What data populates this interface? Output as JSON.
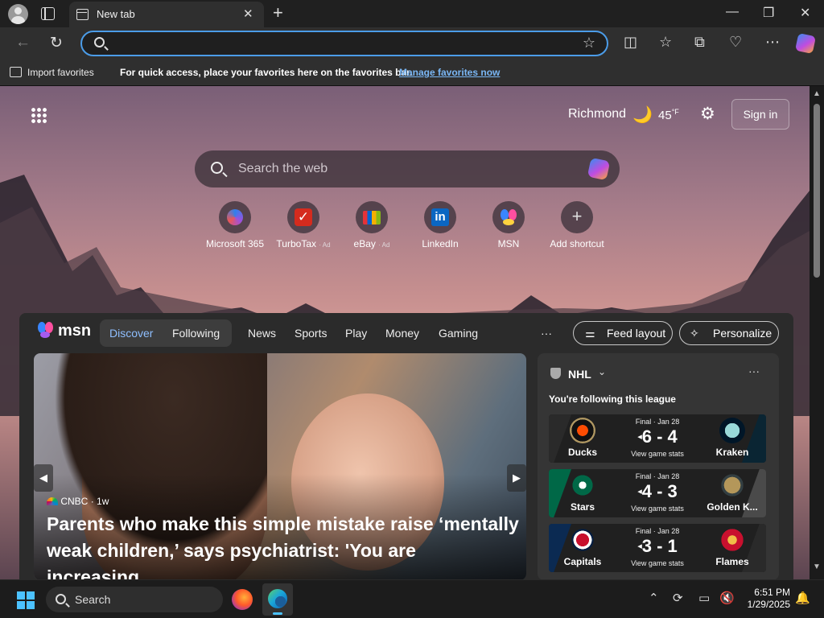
{
  "browser": {
    "tab_title": "New tab",
    "window_controls": {
      "minimize": "—",
      "maximize": "❐",
      "close": "✕"
    },
    "new_tab_glyph": "+",
    "address_placeholder": "",
    "favorites_bar": {
      "import_label": "Import favorites",
      "message": "For quick access, place your favorites here on the favorites bar.",
      "manage_link": "Manage favorites now"
    }
  },
  "newtab": {
    "weather": {
      "city": "Richmond",
      "temperature": "45",
      "unit": "°F"
    },
    "sign_in_label": "Sign in",
    "search_placeholder": "Search the web",
    "shortcuts": [
      {
        "label": "Microsoft 365",
        "ad": ""
      },
      {
        "label": "TurboTax",
        "ad": "· Ad"
      },
      {
        "label": "eBay",
        "ad": "· Ad"
      },
      {
        "label": "LinkedIn",
        "ad": ""
      },
      {
        "label": "MSN",
        "ad": ""
      },
      {
        "label": "Add shortcut",
        "ad": ""
      }
    ]
  },
  "feed": {
    "brand": "msn",
    "tabs": {
      "discover": "Discover",
      "following": "Following"
    },
    "nav": [
      "News",
      "Sports",
      "Play",
      "Money",
      "Gaming"
    ],
    "more": "···",
    "feed_layout_label": "Feed layout",
    "personalize_label": "Personalize",
    "hero": {
      "source": "CNBC",
      "age": "· 1w",
      "headline": "Parents who make this simple mistake raise ‘mentally weak children,’ says psychiatrist: 'You are increasing..."
    }
  },
  "nhl": {
    "league": "NHL",
    "subtitle": "You're following this league",
    "games": [
      {
        "status": "Final · Jan 28",
        "score": "6 - 4",
        "home": "Ducks",
        "away": "Kraken",
        "stats": "View game stats",
        "colorL": "#111111",
        "colorR": "#0a2533"
      },
      {
        "status": "Final · Jan 28",
        "score": "4 - 3",
        "home": "Stars",
        "away": "Golden K...",
        "stats": "View game stats",
        "colorL": "#006847",
        "colorR": "#5b5b5b"
      },
      {
        "status": "Final · Jan 28",
        "score": "3 - 1",
        "home": "Capitals",
        "away": "Flames",
        "stats": "View game stats",
        "colorL": "#0b2a52",
        "colorR": "#111111"
      }
    ]
  },
  "taskbar": {
    "search_label": "Search",
    "time": "6:51 PM",
    "date": "1/29/2025"
  }
}
